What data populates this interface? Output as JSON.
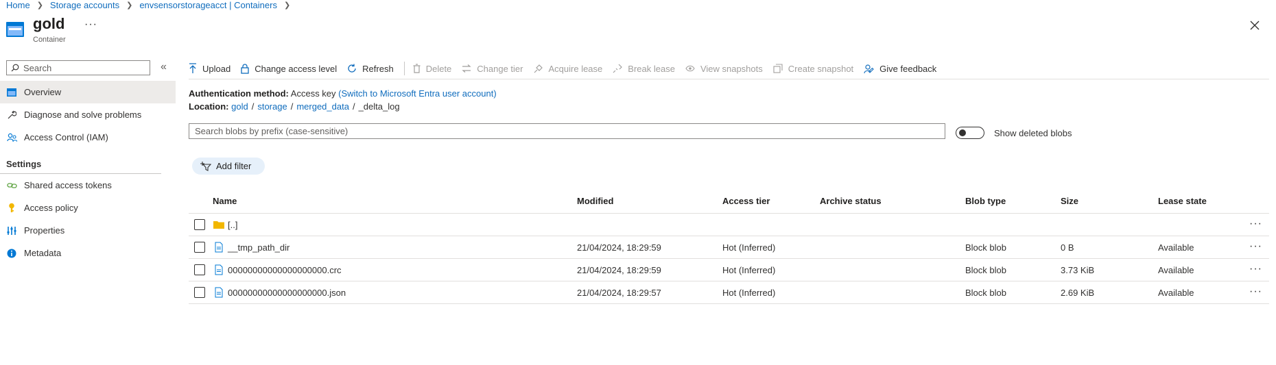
{
  "breadcrumb": [
    "Home",
    "Storage accounts",
    "envsensorstorageacct | Containers"
  ],
  "header": {
    "title": "gold",
    "subtitle": "Container",
    "more": "···"
  },
  "sidebar": {
    "search_placeholder": "Search",
    "collapse": "«",
    "items": [
      {
        "label": "Overview",
        "icon": "overview-icon",
        "active": true
      },
      {
        "label": "Diagnose and solve problems",
        "icon": "wrench-icon"
      },
      {
        "label": "Access Control (IAM)",
        "icon": "people-icon"
      }
    ],
    "settings_title": "Settings",
    "settings_items": [
      {
        "label": "Shared access tokens",
        "icon": "link-icon"
      },
      {
        "label": "Access policy",
        "icon": "key-icon"
      },
      {
        "label": "Properties",
        "icon": "sliders-icon"
      },
      {
        "label": "Metadata",
        "icon": "info-icon"
      }
    ]
  },
  "toolbar": {
    "upload": "Upload",
    "change_access": "Change access level",
    "refresh": "Refresh",
    "delete": "Delete",
    "change_tier": "Change tier",
    "acquire_lease": "Acquire lease",
    "break_lease": "Break lease",
    "view_snapshots": "View snapshots",
    "create_snapshot": "Create snapshot",
    "give_feedback": "Give feedback"
  },
  "auth": {
    "label": "Authentication method:",
    "value": "Access key",
    "switch_link": "(Switch to Microsoft Entra user account)"
  },
  "location": {
    "label": "Location:",
    "path": [
      "gold",
      "storage",
      "merged_data"
    ],
    "current": "_delta_log"
  },
  "blob_search": {
    "placeholder": "Search blobs by prefix (case-sensitive)"
  },
  "show_deleted": {
    "label": "Show deleted blobs",
    "enabled": false
  },
  "add_filter": "Add filter",
  "table": {
    "columns": [
      "Name",
      "Modified",
      "Access tier",
      "Archive status",
      "Blob type",
      "Size",
      "Lease state"
    ],
    "rows": [
      {
        "name": "[..]",
        "type": "folder",
        "modified": "",
        "tier": "",
        "archive": "",
        "blob_type": "",
        "size": "",
        "lease": ""
      },
      {
        "name": "__tmp_path_dir",
        "type": "file",
        "modified": "21/04/2024, 18:29:59",
        "tier": "Hot (Inferred)",
        "archive": "",
        "blob_type": "Block blob",
        "size": "0 B",
        "lease": "Available"
      },
      {
        "name": "00000000000000000000.crc",
        "type": "file",
        "modified": "21/04/2024, 18:29:59",
        "tier": "Hot (Inferred)",
        "archive": "",
        "blob_type": "Block blob",
        "size": "3.73 KiB",
        "lease": "Available"
      },
      {
        "name": "00000000000000000000.json",
        "type": "file",
        "modified": "21/04/2024, 18:29:57",
        "tier": "Hot (Inferred)",
        "archive": "",
        "blob_type": "Block blob",
        "size": "2.69 KiB",
        "lease": "Available"
      }
    ],
    "row_more": "···"
  }
}
